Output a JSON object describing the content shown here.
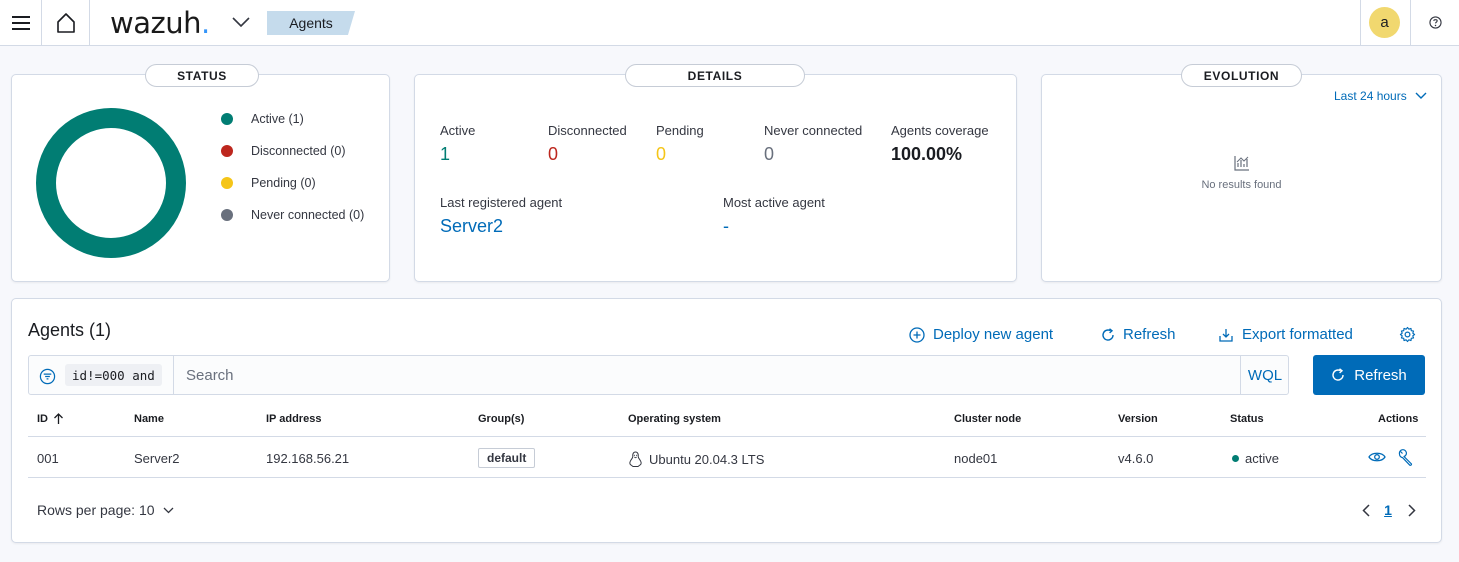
{
  "header": {
    "logo_text": "wazuh",
    "logo_dot": ".",
    "breadcrumb": "Agents",
    "avatar_initial": "a",
    "menu_icon": "hamburger-icon",
    "home_icon": "home-icon",
    "help_icon": "help-icon"
  },
  "status_panel": {
    "title": "STATUS",
    "legend": [
      {
        "label": "Active (1)",
        "color": "#017d73",
        "count": 1
      },
      {
        "label": "Disconnected (0)",
        "color": "#bd271e",
        "count": 0
      },
      {
        "label": "Pending (0)",
        "color": "#f5c518",
        "count": 0
      },
      {
        "label": "Never connected (0)",
        "color": "#69707d",
        "count": 0
      }
    ]
  },
  "details_panel": {
    "title": "DETAILS",
    "stats": [
      {
        "label": "Active",
        "value": "1",
        "color": "#017d73"
      },
      {
        "label": "Disconnected",
        "value": "0",
        "color": "#bd271e"
      },
      {
        "label": "Pending",
        "value": "0",
        "color": "#f5c518"
      },
      {
        "label": "Never connected",
        "value": "0",
        "color": "#69707d"
      },
      {
        "label": "Agents coverage",
        "value": "100.00%",
        "color": "#1a1c21"
      }
    ],
    "last_registered_label": "Last registered agent",
    "last_registered_value": "Server2",
    "most_active_label": "Most active agent",
    "most_active_value": "-"
  },
  "evolution_panel": {
    "title": "EVOLUTION",
    "range_label": "Last 24 hours",
    "empty_text": "No results found"
  },
  "agents_table": {
    "title": "Agents (1)",
    "deploy_label": "Deploy new agent",
    "refresh_label": "Refresh",
    "export_label": "Export formatted",
    "query_chip": "id!=000 and",
    "search_placeholder": "Search",
    "wql_label": "WQL",
    "refresh_button_label": "Refresh",
    "columns": [
      "ID",
      "Name",
      "IP address",
      "Group(s)",
      "Operating system",
      "Cluster node",
      "Version",
      "Status",
      "Actions"
    ],
    "rows": [
      {
        "id": "001",
        "name": "Server2",
        "ip": "192.168.56.21",
        "group": "default",
        "os": "Ubuntu 20.04.3 LTS",
        "node": "node01",
        "version": "v4.6.0",
        "status": "active"
      }
    ],
    "rows_per_page_label": "Rows per page: 10",
    "current_page": "1"
  },
  "colors": {
    "accent": "#006bb8",
    "active": "#017d73",
    "disconnected": "#bd271e",
    "pending": "#f5c518",
    "never_connected": "#69707d"
  }
}
